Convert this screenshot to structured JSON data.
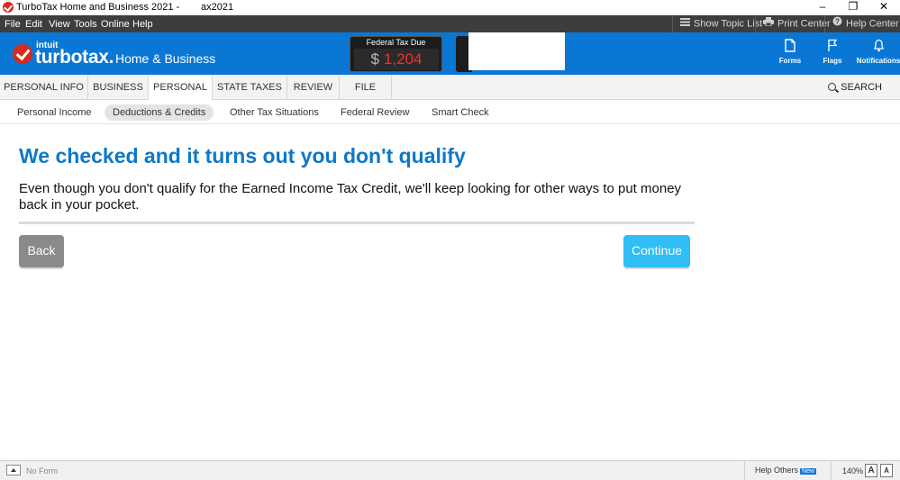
{
  "window": {
    "title": "TurboTax Home and Business 2021 -",
    "title_suffix": "ax2021",
    "controls": {
      "minimize": "–",
      "restore": "❐",
      "close": "✕"
    }
  },
  "menu": {
    "items": [
      "File",
      "Edit",
      "View",
      "Tools",
      "Online",
      "Help"
    ],
    "right": {
      "topic_list": "Show Topic List",
      "print_center": "Print Center",
      "help_center": "Help Center"
    }
  },
  "brand": {
    "intuit": "intuit",
    "name": "turbotax.",
    "edition": "Home & Business"
  },
  "tax_due": {
    "label": "Federal Tax Due",
    "currency": "$",
    "amount": "1,204"
  },
  "header_buttons": {
    "forms": "Forms",
    "flags": "Flags",
    "notifications": "Notifications"
  },
  "tabs": [
    {
      "label": "PERSONAL INFO",
      "active": false
    },
    {
      "label": "BUSINESS",
      "active": false
    },
    {
      "label": "PERSONAL",
      "active": true
    },
    {
      "label": "STATE TAXES",
      "active": false
    },
    {
      "label": "REVIEW",
      "active": false
    },
    {
      "label": "FILE",
      "active": false
    }
  ],
  "search_label": "SEARCH",
  "subnav": [
    {
      "label": "Personal Income",
      "active": false
    },
    {
      "label": "Deductions & Credits",
      "active": true
    },
    {
      "label": "Other Tax Situations",
      "active": false
    },
    {
      "label": "Federal Review",
      "active": false
    },
    {
      "label": "Smart Check",
      "active": false
    }
  ],
  "content": {
    "headline": "We checked and it turns out you don't qualify",
    "body": "Even though you don't qualify for the Earned Income Tax Credit, we'll keep looking for other ways to put money back in your pocket.",
    "back_label": "Back",
    "continue_label": "Continue"
  },
  "status": {
    "form": "No Form",
    "help_others": "Help Others",
    "new_badge": "New",
    "zoom": "140%",
    "font_a": "A"
  },
  "colors": {
    "brand_blue": "#0a77d5",
    "headline_blue": "#0e78c6",
    "continue_blue": "#2fbef5",
    "back_gray": "#8a8a8a",
    "tax_red": "#e8362f"
  }
}
